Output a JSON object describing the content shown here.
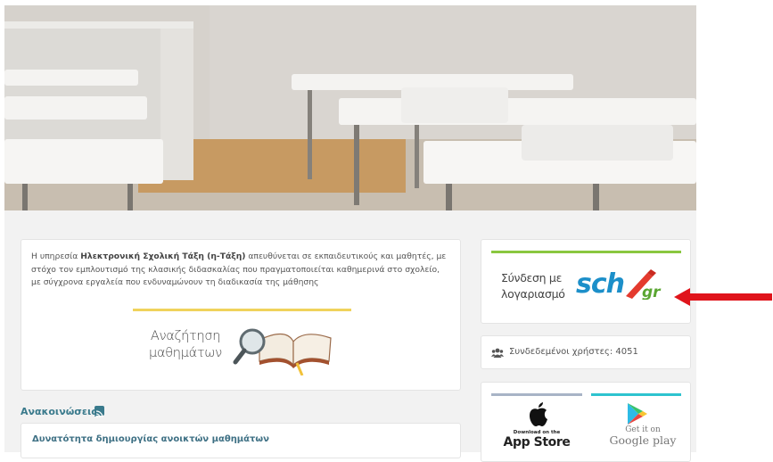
{
  "intro": {
    "part1": "Η υπηρεσία ",
    "bold": "Ηλεκτρονική Σχολική Τάξη (η-Τάξη)",
    "part2": " απευθύνεται σε εκπαιδευτικούς και μαθητές, με στόχο τον εμπλουτισμό της κλασικής διδασκαλίας που πραγματοποιείται καθημερινά στο σχολείο, με σύγχρονα εργαλεία που ενδυναμώνουν τη διαδικασία της μάθησης"
  },
  "search": {
    "line1": "Αναζήτηση",
    "line2": "μαθημάτων"
  },
  "announcements": {
    "title": "Ανακοινώσεις",
    "items": [
      "Δυνατότητα δημιουργίας ανοικτών μαθημάτων"
    ]
  },
  "login": {
    "line1": "Σύνδεση με",
    "line2": "λογαριασμό",
    "logo": "sch",
    "logo_suffix": "gr"
  },
  "users": {
    "text": "Συνδεδεμένοι χρήστες: 4051"
  },
  "apps": {
    "appstore_small": "Download on the",
    "appstore_big": "App Store",
    "gplay_small": "Get it on",
    "gplay_big": "Google play"
  },
  "colors": {
    "accent_yellow": "#f0d35c",
    "accent_green": "#8ac740",
    "link_teal": "#3a7a8c",
    "sch_blue": "#1c8fc9",
    "arrow_red": "#e0141b"
  },
  "icons": [
    "rss-icon",
    "users-icon",
    "apple-icon",
    "google-play-icon",
    "magnifier-book-icon",
    "red-arrow-icon"
  ]
}
